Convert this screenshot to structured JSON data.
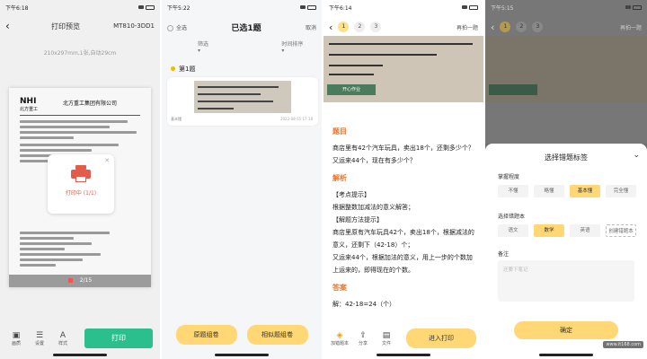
{
  "screen1": {
    "status_time": "下午6:18",
    "title": "打印预览",
    "printer": "MT810-3DD1",
    "paper_size": "210x297mm,1张,自动29cm",
    "doc": {
      "logo": "NHI",
      "logo_sub": "北方重工",
      "company": "北方重工集团有限公司"
    },
    "dialog_text": "打印中 (1/1)",
    "pager": "2/15",
    "toolbar": [
      {
        "label": "画质",
        "icon": "image-icon"
      },
      {
        "label": "设置",
        "icon": "sliders-icon"
      },
      {
        "label": "样式",
        "icon": "text-style-icon"
      }
    ],
    "print_label": "打印"
  },
  "screen2": {
    "status_time": "下午5:22",
    "select_all": "全选",
    "title": "已选1题",
    "cancel": "取消",
    "filter_subject": "筛选",
    "filter_time": "时间排序",
    "item_title": "第1题",
    "card_meta": "基本懂",
    "card_date": "2022-08-15 17:18",
    "btn_original": "原题组卷",
    "btn_similar": "相似题组卷"
  },
  "screen3": {
    "status_time": "下午6:14",
    "tabs": [
      "1",
      "2",
      "3"
    ],
    "reshoot": "再拍一题",
    "stamp": "开心作业",
    "section_question": "题目",
    "question": "商店里有42个汽车玩具，卖出18个，还剩多少个？又运来44个，现在有多少个？",
    "section_analysis": "解析",
    "analysis_lines": [
      "【考点提示】",
      "根据整数加减法的意义解答；",
      "【解题方法提示】",
      "商店里原有汽车玩具42个，卖出18个，根据减法的意义，还剩下（42-18）个；",
      "又运来44个，根据加法的意义，用上一步的个数加上运来的，即得现在的个数。"
    ],
    "section_answer": "答案",
    "answer_line": "解：42-18=24（个）",
    "toolbar": [
      {
        "label": "加错题本",
        "icon": "bookmark-icon"
      },
      {
        "label": "分享",
        "icon": "share-icon"
      },
      {
        "label": "文件",
        "icon": "document-icon"
      }
    ],
    "print_label": "进入打印"
  },
  "screen4": {
    "status_time": "下午5:15",
    "reshoot": "再拍一题",
    "tabs": [
      "1",
      "2",
      "3"
    ],
    "sheet_title": "选择错题标签",
    "mastery_label": "掌握程度",
    "mastery_options": [
      "不懂",
      "略懂",
      "基本懂",
      "完全懂"
    ],
    "mastery_selected": 2,
    "book_label": "选择错题本",
    "book_options": [
      "语文",
      "数学",
      "英语",
      "创建错题本"
    ],
    "book_selected": 1,
    "notes_label": "备注",
    "notes_placeholder": "还要下笔记",
    "confirm": "确定",
    "watermark": "www.it168.com"
  }
}
